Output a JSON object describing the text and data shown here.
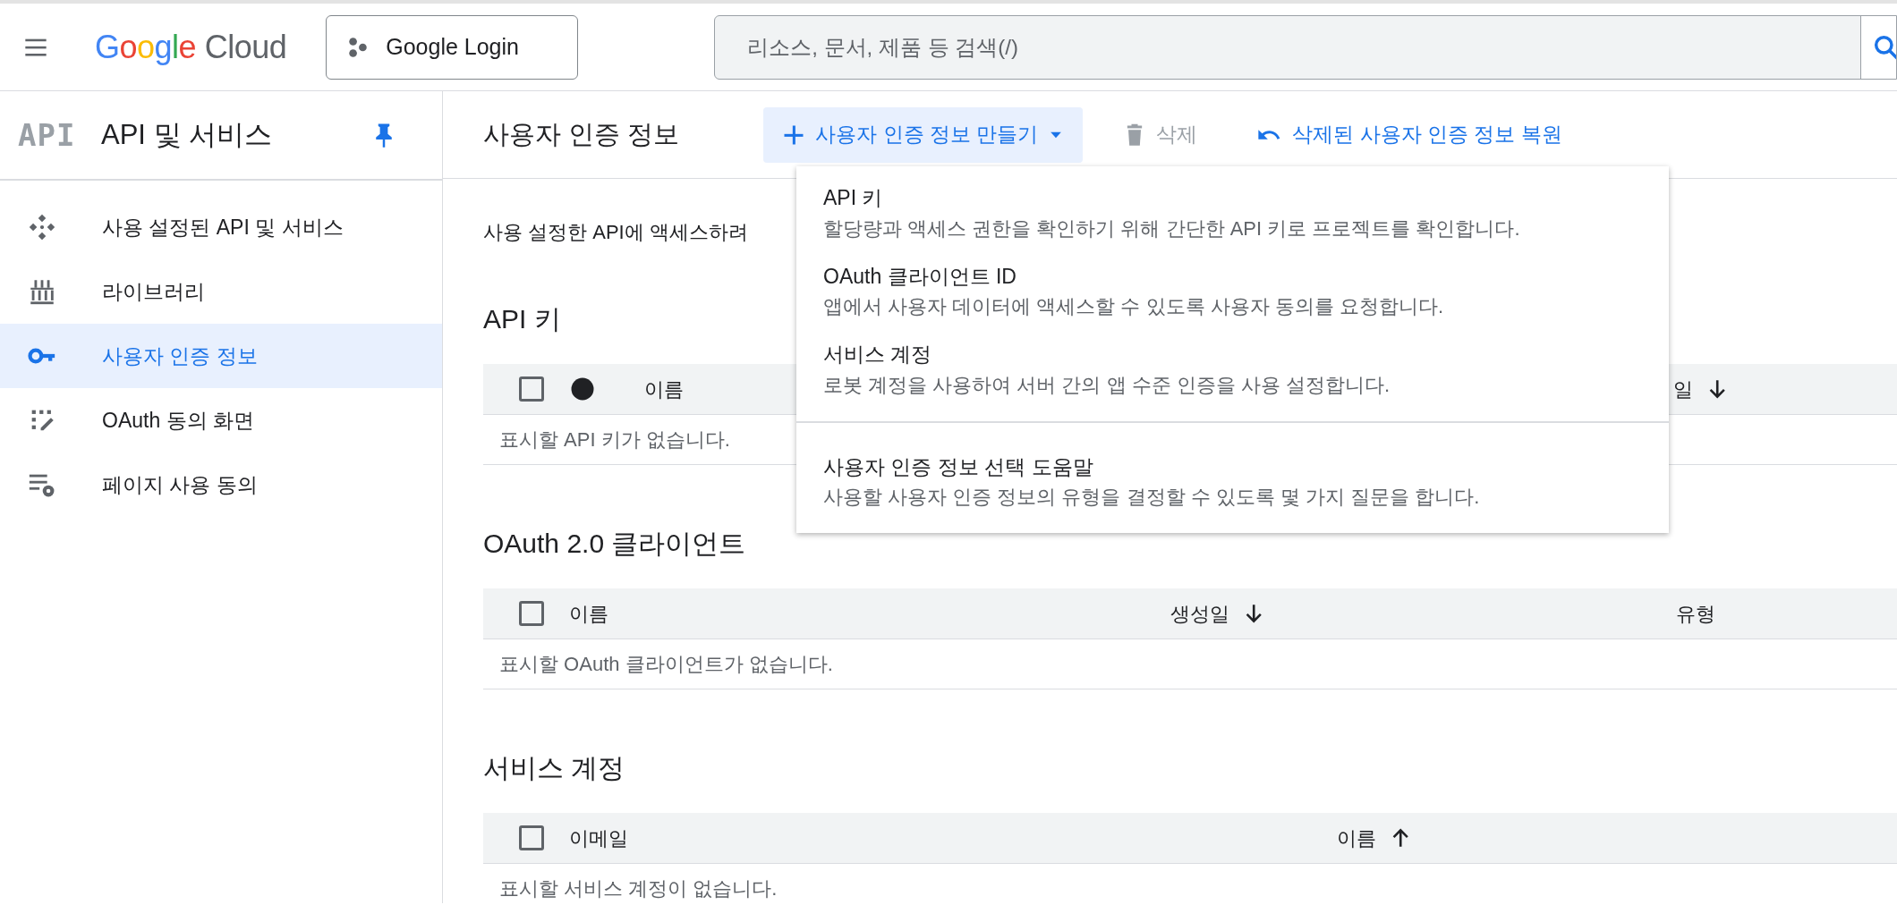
{
  "topbar": {
    "logo": "Google Cloud",
    "project_button": "Google Login",
    "search": {
      "placeholder": "리소스, 문서, 제품 등 검색(/)"
    }
  },
  "sidebar": {
    "header_icon_text": "API",
    "title": "API 및 서비스",
    "pinned": true,
    "items": [
      {
        "label": "사용 설정된 API 및 서비스",
        "selected": false
      },
      {
        "label": "라이브러리",
        "selected": false
      },
      {
        "label": "사용자 인증 정보",
        "selected": true
      },
      {
        "label": "OAuth 동의 화면",
        "selected": false
      },
      {
        "label": "페이지 사용 동의",
        "selected": false
      }
    ]
  },
  "page": {
    "title": "사용자 인증 정보",
    "actions": [
      {
        "kind": "create",
        "label": "사용자 인증 정보 만들기",
        "disabled": false,
        "expanded": true
      },
      {
        "kind": "delete",
        "label": "삭제",
        "disabled": true
      },
      {
        "kind": "restore",
        "label": "삭제된 사용자 인증 정보 복원",
        "disabled": false
      }
    ],
    "menu": {
      "sections": [
        [
          {
            "title": "API 키",
            "description": "할당량과 액세스 권한을 확인하기 위해 간단한 API 키로 프로젝트를 확인합니다."
          },
          {
            "title": "OAuth 클라이언트 ID",
            "description": "앱에서 사용자 데이터에 액세스할 수 있도록 사용자 동의를 요청합니다."
          },
          {
            "title": "서비스 계정",
            "description": "로봇 계정을 사용하여 서버 간의 앱 수준 인증을 사용 설정합니다."
          }
        ],
        [
          {
            "title": "사용자 인증 정보 선택 도움말",
            "description": "사용할 사용자 인증 정보의 유형을 결정할 수 있도록 몇 가지 질문을 합니다."
          }
        ]
      ]
    },
    "intro": "사용 설정한 API에 액세스하려",
    "sections": [
      {
        "heading": "API 키",
        "checked": false,
        "columns": [
          {
            "kind": "status"
          },
          {
            "kind": "text",
            "label": "이름"
          },
          {
            "kind": "partial",
            "label": "일",
            "sorted": true,
            "descending": true
          }
        ],
        "empty": "표시할 API 키가 없습니다."
      },
      {
        "heading": "OAuth 2.0 클라이언트",
        "checked": false,
        "columns": [
          {
            "kind": "text",
            "label": "이름"
          },
          {
            "kind": "text",
            "label": "생성일",
            "sorted": true,
            "descending": true
          },
          {
            "kind": "text",
            "label": "유형"
          }
        ],
        "empty": "표시할 OAuth 클라이언트가 없습니다."
      },
      {
        "heading": "서비스 계정",
        "checked": false,
        "columns": [
          {
            "kind": "text",
            "label": "이메일"
          },
          {
            "kind": "text",
            "label": "이름",
            "sorted": true,
            "descending": false
          }
        ],
        "empty": "표시할 서비스 계정이 없습니다."
      }
    ]
  }
}
